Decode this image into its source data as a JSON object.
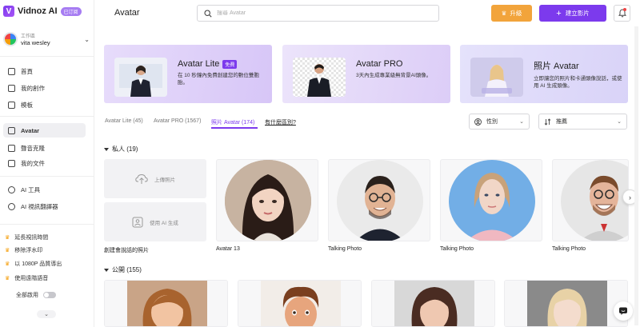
{
  "app": {
    "logo_text": "Vidnoz AI",
    "logo_mark": "V",
    "logo_badge": "已订阅",
    "page_title": "Avatar"
  },
  "workspace": {
    "label": "工作區",
    "name": "vita wesley"
  },
  "nav": [
    {
      "label": "首頁",
      "icon": "home-icon"
    },
    {
      "label": "我的創作",
      "icon": "video-icon"
    },
    {
      "label": "模板",
      "icon": "template-icon"
    },
    {
      "label": "Avatar",
      "icon": "avatar-icon"
    },
    {
      "label": "聲音克隆",
      "icon": "voice-icon"
    },
    {
      "label": "我的文件",
      "icon": "folder-icon"
    },
    {
      "label": "AI 工具",
      "icon": "tools-icon"
    },
    {
      "label": "AI 視訊翻譯器",
      "icon": "translate-icon"
    }
  ],
  "promos": [
    "延長視訊時間",
    "移除浮水印",
    "以 1080P 品質導出",
    "使用遠階語音"
  ],
  "apply_all": "全部啟用",
  "search": {
    "placeholder": "搜尋 Avatar"
  },
  "header": {
    "upgrade": "升級",
    "create": "建立影片"
  },
  "banners": [
    {
      "title": "Avatar Lite",
      "badge": "免費",
      "desc": "在 10 秒鐘內免費創建您的數位雙胞胎。"
    },
    {
      "title": "Avatar PRO",
      "badge": "",
      "desc": "3天內生成專業級無背景AI頭像。"
    },
    {
      "title": "照片 Avatar",
      "badge": "",
      "desc": "立即讓您的照片和卡通頭像說話，或使用 AI 生成頭像。"
    }
  ],
  "tabs": [
    {
      "label": "Avatar Lite (45)"
    },
    {
      "label": "Avatar PRO (1567)"
    },
    {
      "label": "照片 Avatar (174)"
    },
    {
      "label": "有什麼區別?"
    }
  ],
  "filters": {
    "gender": "性別",
    "sort": "推薦"
  },
  "private_section": {
    "label": "私人 (19)"
  },
  "upload": {
    "upload_label": "上傳照片",
    "ai_label": "使用 AI 生成",
    "caption": "創建會說話的照片"
  },
  "cards": [
    {
      "caption": "Avatar 13"
    },
    {
      "caption": "Talking Photo"
    },
    {
      "caption": "Talking Photo"
    },
    {
      "caption": "Talking Photo"
    }
  ],
  "public_section": {
    "label": "公開 (155)"
  },
  "colors": {
    "accent": "#7c3aed",
    "upgrade": "#f2a43b"
  }
}
